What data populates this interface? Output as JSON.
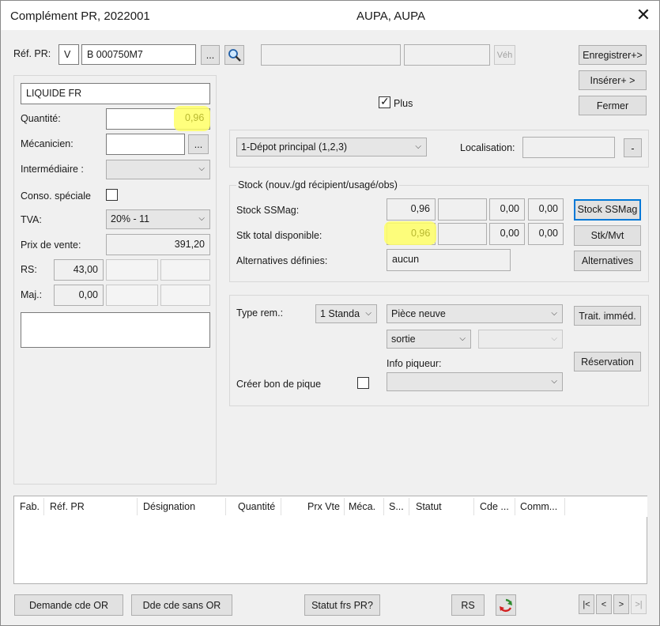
{
  "window": {
    "title": "Complément PR, 2022001",
    "customer": "AUPA, AUPA",
    "close": "✕"
  },
  "header": {
    "ref_label": "Réf. PR:",
    "ref_prefix": "V",
    "ref_value": "B  000750M7",
    "browse_label": "...",
    "vehicle_label": "Véh",
    "field1": "",
    "field2": ""
  },
  "right_buttons": {
    "save": "Enregistrer+>",
    "insert": "Insérer+ >",
    "close": "Fermer"
  },
  "left": {
    "designation": "LIQUIDE FR",
    "quantity_label": "Quantité:",
    "quantity_value": "0,96",
    "mechanic_label": "Mécanicien:",
    "mechanic_value": "",
    "mechanic_browse": "...",
    "intermediate_label": "Intermédiaire :",
    "intermediate_value": "",
    "conso_label": "Conso. spéciale",
    "tva_label": "TVA:",
    "tva_value": "20% - 11",
    "price_label": "Prix de vente:",
    "price_value": "391,20",
    "rs_label": "RS:",
    "rs_value": "43,00",
    "maj_label": "Maj.:",
    "maj_value": "0,00"
  },
  "plus": {
    "label": "Plus",
    "checked": true
  },
  "depot": {
    "value": "1-Dépot principal (1,2,3)",
    "location_label": "Localisation:",
    "location_value": "",
    "dash_label": "-"
  },
  "stock": {
    "group_title": "Stock (nouv./gd récipient/usagé/obs)",
    "ssmag_label": "Stock SSMag:",
    "ssmag_values": [
      "0,96",
      "",
      "0,00",
      "0,00"
    ],
    "total_label": "Stk total disponible:",
    "total_values": [
      "0,96",
      "",
      "0,00",
      "0,00"
    ],
    "alt_label": "Alternatives définies:",
    "alt_value": "aucun",
    "btn_ssmag": "Stock SSMag",
    "btn_stkmvt": "Stk/Mvt",
    "btn_alt": "Alternatives"
  },
  "type": {
    "type_label": "Type rem.:",
    "type_value": "1 Standa",
    "piece_value": "Pièce neuve",
    "sortie_value": "sortie",
    "info_label": "Info piqueur:",
    "bon_label": "Créer bon de pique",
    "btn_trait": "Trait. imméd.",
    "btn_reservation": "Réservation"
  },
  "grid": {
    "columns": [
      "Fab.",
      "Réf. PR",
      "Désignation",
      "Quantité",
      "Prx Vte",
      "Méca.",
      "S...",
      "Statut",
      "Cde ...",
      "Comm..."
    ]
  },
  "footer": {
    "demande": "Demande cde OR",
    "dde": "Dde cde sans OR",
    "statut": "Statut frs PR?",
    "rs": "RS",
    "nav": [
      "|<",
      "<",
      ">",
      ">|"
    ]
  },
  "colors": {
    "highlight": "#ffff66",
    "focus": "#0078d7"
  }
}
